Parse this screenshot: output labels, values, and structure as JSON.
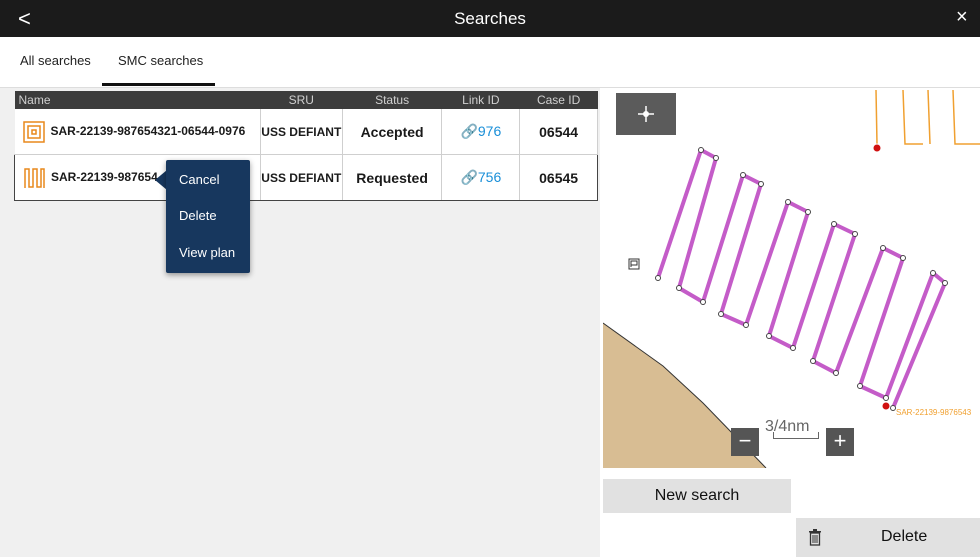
{
  "titlebar": {
    "title": "Searches",
    "back_glyph": "<",
    "close_glyph": "×"
  },
  "tabs": [
    {
      "label": "All searches"
    },
    {
      "label": "SMC searches",
      "active": true
    }
  ],
  "table": {
    "columns": [
      "Name",
      "SRU",
      "Status",
      "Link ID",
      "Case ID"
    ],
    "rows": [
      {
        "pattern_icon": "expanding-square-pattern-icon",
        "name": "SAR-22139-987654321-06544-0976",
        "sru": "USS DEFIANT",
        "status": "Accepted",
        "link_id": "976",
        "case_id": "06544"
      },
      {
        "pattern_icon": "parallel-track-pattern-icon",
        "name": "SAR-22139-987654",
        "sru": "USS DEFIANT",
        "status": "Requested",
        "link_id": "756",
        "case_id": "06545"
      }
    ]
  },
  "context_menu": {
    "items": [
      "Cancel",
      "Delete",
      "View plan"
    ]
  },
  "map": {
    "scale_label": "3/4nm",
    "track_label": "SAR-22139-9876543",
    "zoom_out_glyph": "−",
    "zoom_in_glyph": "+",
    "colors": {
      "track": "#c45cc8",
      "land": "#d8bd93",
      "label": "#f0a030",
      "marker": "#d01010"
    }
  },
  "buttons": {
    "new_search": "New search",
    "delete": "Delete"
  }
}
